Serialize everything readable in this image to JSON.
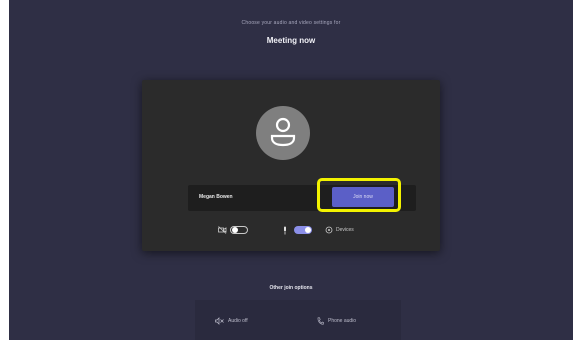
{
  "header": {
    "subtitle": "Choose your audio and video settings for",
    "title": "Meeting now"
  },
  "prejoin": {
    "display_name": "Megan Bowen",
    "join_button": "Join now",
    "video_toggle": {
      "icon": "camera-off-icon",
      "state": "off"
    },
    "mic_toggle": {
      "icon": "microphone-icon",
      "state": "on"
    },
    "device_settings_label": "Devices"
  },
  "other_options": {
    "label": "Other join options",
    "audio_off": "Audio off",
    "phone_audio": "Phone audio"
  },
  "colors": {
    "background": "#2f2f45",
    "card": "#2b2b2b",
    "accent": "#5b5fc7",
    "highlight": "#f2f200"
  }
}
